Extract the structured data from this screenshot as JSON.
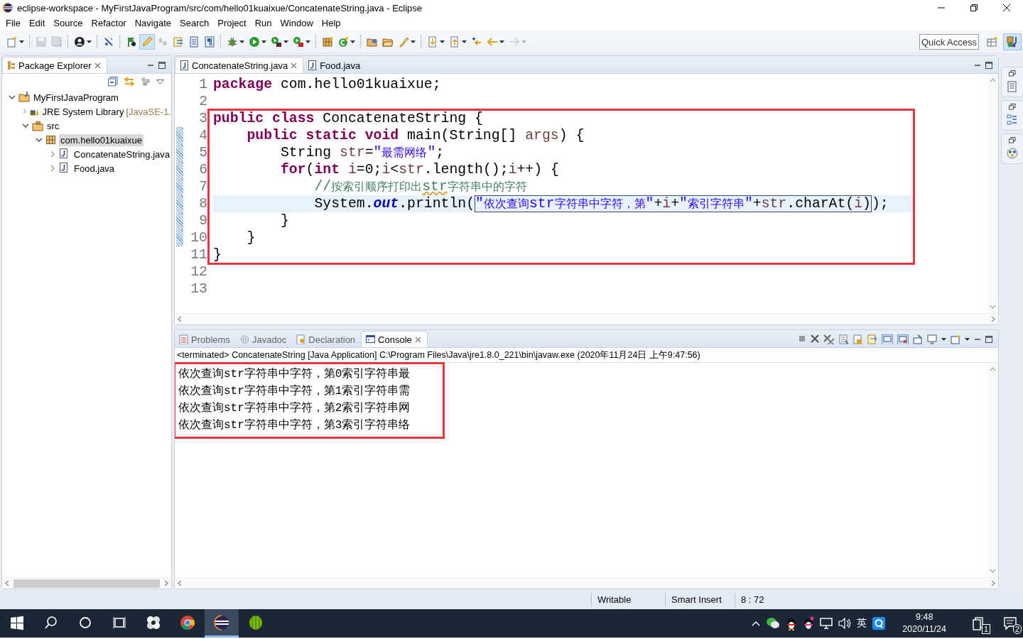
{
  "window": {
    "title": "eclipse-workspace - MyFirstJavaProgram/src/com/hello01kuaixue/ConcatenateString.java - Eclipse"
  },
  "menu": [
    "File",
    "Edit",
    "Source",
    "Refactor",
    "Navigate",
    "Search",
    "Project",
    "Run",
    "Window",
    "Help"
  ],
  "toolbar": [
    {
      "kind": "button",
      "dropdown": true,
      "disabled": false,
      "selected": false
    },
    {
      "kind": "separator"
    },
    {
      "kind": "button",
      "dropdown": false,
      "disabled": true,
      "selected": false
    },
    {
      "kind": "button",
      "dropdown": false,
      "disabled": true,
      "selected": false
    },
    {
      "kind": "separator"
    },
    {
      "kind": "button",
      "dropdown": true,
      "disabled": false,
      "selected": false
    },
    {
      "kind": "separator"
    },
    {
      "kind": "button",
      "dropdown": false,
      "disabled": false,
      "selected": false
    },
    {
      "kind": "separator"
    },
    {
      "kind": "button",
      "dropdown": false,
      "disabled": false,
      "selected": false
    },
    {
      "kind": "button",
      "dropdown": false,
      "disabled": false,
      "selected": true
    },
    {
      "kind": "button",
      "dropdown": false,
      "disabled": true,
      "selected": false
    },
    {
      "kind": "button",
      "dropdown": false,
      "disabled": false,
      "selected": false
    },
    {
      "kind": "button",
      "dropdown": false,
      "disabled": false,
      "selected": false
    },
    {
      "kind": "button",
      "dropdown": false,
      "disabled": false,
      "selected": false
    },
    {
      "kind": "separator"
    },
    {
      "kind": "button",
      "dropdown": true,
      "disabled": false,
      "selected": false
    },
    {
      "kind": "button",
      "dropdown": true,
      "disabled": false,
      "selected": false
    },
    {
      "kind": "button",
      "dropdown": true,
      "disabled": false,
      "selected": false
    },
    {
      "kind": "button",
      "dropdown": true,
      "disabled": false,
      "selected": false
    },
    {
      "kind": "separator"
    },
    {
      "kind": "button",
      "dropdown": false,
      "disabled": false,
      "selected": false
    },
    {
      "kind": "button",
      "dropdown": true,
      "disabled": false,
      "selected": false
    },
    {
      "kind": "separator"
    },
    {
      "kind": "button",
      "dropdown": false,
      "disabled": false,
      "selected": false
    },
    {
      "kind": "button",
      "dropdown": false,
      "disabled": false,
      "selected": false
    },
    {
      "kind": "button",
      "dropdown": true,
      "disabled": false,
      "selected": false
    },
    {
      "kind": "separator"
    },
    {
      "kind": "button",
      "dropdown": true,
      "disabled": false,
      "selected": false
    },
    {
      "kind": "button",
      "dropdown": true,
      "disabled": false,
      "selected": false
    },
    {
      "kind": "button",
      "dropdown": false,
      "disabled": false,
      "selected": false
    },
    {
      "kind": "button",
      "dropdown": true,
      "disabled": false,
      "selected": false
    },
    {
      "kind": "button",
      "dropdown": true,
      "disabled": true,
      "selected": false
    }
  ],
  "quick_access": {
    "placeholder": "Quick Access"
  },
  "perspectives": [
    {
      "selected": false
    },
    {
      "selected": true
    }
  ],
  "package_explorer": {
    "title": "Package Explorer",
    "tree": [
      {
        "label": "MyFirstJavaProgram",
        "kind": "project",
        "expanded": true,
        "selected": false,
        "children": [
          {
            "label": "JRE System Library",
            "suffix": "[JavaSE-1.",
            "kind": "library",
            "expanded": false,
            "selected": false
          },
          {
            "label": "src",
            "kind": "source",
            "expanded": true,
            "selected": false,
            "children": [
              {
                "label": "com.hello01kuaixue",
                "kind": "package",
                "expanded": true,
                "selected": true,
                "children": [
                  {
                    "label": "ConcatenateString.java",
                    "kind": "file",
                    "expanded": false,
                    "selected": false
                  },
                  {
                    "label": "Food.java",
                    "kind": "file",
                    "expanded": false,
                    "selected": false
                  }
                ]
              }
            ]
          }
        ]
      }
    ]
  },
  "editor": {
    "tabs": [
      {
        "label": "ConcatenateString.java",
        "selected": true
      },
      {
        "label": "Food.java",
        "selected": false
      }
    ],
    "lines": [
      {
        "number": "1",
        "current": false,
        "framed": false,
        "in_range": false,
        "tokens": [
          {
            "t": "package",
            "kind": "kw"
          },
          {
            "t": " com.hello01kuaixue;",
            "kind": "plain"
          }
        ]
      },
      {
        "number": "2",
        "current": false,
        "framed": false,
        "in_range": false
      },
      {
        "number": "3",
        "current": false,
        "framed": true,
        "in_range": false,
        "tokens": [
          {
            "t": "public class",
            "kind": "kw"
          },
          {
            "t": " ConcatenateString {",
            "kind": "plain"
          }
        ]
      },
      {
        "number": "4",
        "current": false,
        "framed": true,
        "in_range": true,
        "tokens": [
          {
            "t": "    public static void",
            "kind": "kw"
          },
          {
            "t": " main(String[] ",
            "kind": "plain"
          },
          {
            "t": "args",
            "kind": "local"
          },
          {
            "t": ") {",
            "kind": "plain"
          }
        ]
      },
      {
        "number": "5",
        "current": false,
        "framed": true,
        "in_range": true,
        "tokens": [
          {
            "t": "        String ",
            "kind": "plain"
          },
          {
            "t": "str",
            "kind": "local"
          },
          {
            "t": "=",
            "kind": "plain"
          },
          {
            "t": "\"最需网络\"",
            "kind": "str"
          },
          {
            "t": ";",
            "kind": "plain"
          }
        ]
      },
      {
        "number": "6",
        "current": false,
        "framed": true,
        "in_range": true,
        "tokens": [
          {
            "t": "        for",
            "kind": "kw"
          },
          {
            "t": "(",
            "kind": "plain"
          },
          {
            "t": "int ",
            "kind": "kw"
          },
          {
            "t": "i",
            "kind": "local"
          },
          {
            "t": "=0;",
            "kind": "plain"
          },
          {
            "t": "i",
            "kind": "local"
          },
          {
            "t": "<",
            "kind": "plain"
          },
          {
            "t": "str",
            "kind": "local"
          },
          {
            "t": ".length();",
            "kind": "plain"
          },
          {
            "t": "i",
            "kind": "local"
          },
          {
            "t": "++) {",
            "kind": "plain"
          }
        ]
      },
      {
        "number": "7",
        "current": false,
        "framed": true,
        "in_range": true,
        "tokens": [
          {
            "t": "            //按索引顺序打印出",
            "kind": "comment"
          },
          {
            "t": "str",
            "kind": "typo"
          },
          {
            "t": "字符串中的字符",
            "kind": "comment"
          }
        ]
      },
      {
        "number": "8",
        "current": true,
        "framed": true,
        "in_range": true,
        "tokens": [
          {
            "t": "            System.",
            "kind": "plain"
          },
          {
            "t": "out",
            "kind": "field"
          },
          {
            "t": ".println(",
            "kind": "plain"
          },
          {
            "t": "\"依次查询str字符串中字符，第\"",
            "kind": "str",
            "boxed": true
          },
          {
            "t": "+",
            "kind": "plain",
            "boxed": true
          },
          {
            "t": "i",
            "kind": "local",
            "boxed": true
          },
          {
            "t": "+",
            "kind": "plain",
            "boxed": true
          },
          {
            "t": "\"索引字符串\"",
            "kind": "str",
            "boxed": true
          },
          {
            "t": "+",
            "kind": "plain",
            "boxed": true
          },
          {
            "t": "str",
            "kind": "local",
            "boxed": true
          },
          {
            "t": ".charAt(",
            "kind": "plain",
            "boxed": true
          },
          {
            "t": "i",
            "kind": "local",
            "boxed": true
          },
          {
            "t": ")",
            "kind": "plain",
            "boxed": true
          },
          {
            "t": ");",
            "kind": "plain"
          }
        ]
      },
      {
        "number": "9",
        "current": false,
        "framed": true,
        "in_range": true,
        "tokens": [
          {
            "t": "        }",
            "kind": "plain"
          }
        ]
      },
      {
        "number": "10",
        "current": false,
        "framed": true,
        "in_range": true,
        "tokens": [
          {
            "t": "    }",
            "kind": "plain"
          }
        ]
      },
      {
        "number": "11",
        "current": false,
        "framed": true,
        "in_range": false,
        "tokens": [
          {
            "t": "}",
            "kind": "plain"
          }
        ]
      },
      {
        "number": "12",
        "current": false,
        "framed": false,
        "in_range": false
      },
      {
        "number": "13",
        "current": false,
        "framed": false,
        "in_range": false
      }
    ]
  },
  "console": {
    "tabs": [
      {
        "label": "Problems",
        "selected": false
      },
      {
        "label": "Javadoc",
        "selected": false
      },
      {
        "label": "Declaration",
        "selected": false
      },
      {
        "label": "Console",
        "selected": true
      }
    ],
    "header": "<terminated> ConcatenateString [Java Application] C:\\Program Files\\Java\\jre1.8.0_221\\bin\\javaw.exe (2020年11月24日 上午9:47:56)",
    "lines": [
      {
        "text": "依次查询str字符串中字符，第0索引字符串最",
        "framed": true
      },
      {
        "text": "依次查询str字符串中字符，第1索引字符串需",
        "framed": true
      },
      {
        "text": "依次查询str字符串中字符，第2索引字符串网",
        "framed": true
      },
      {
        "text": "依次查询str字符串中字符，第3索引字符串络",
        "framed": true
      }
    ]
  },
  "status_bar": [
    "Writable",
    "Smart Insert",
    "8 : 72"
  ],
  "taskbar": {
    "apps": [
      {
        "selected": false
      },
      {
        "selected": false
      },
      {
        "selected": true
      },
      {
        "selected": false
      }
    ],
    "language": "英",
    "tray_badge": "1",
    "notifications": "2",
    "time": "9:48",
    "date": "2020/11/24"
  }
}
